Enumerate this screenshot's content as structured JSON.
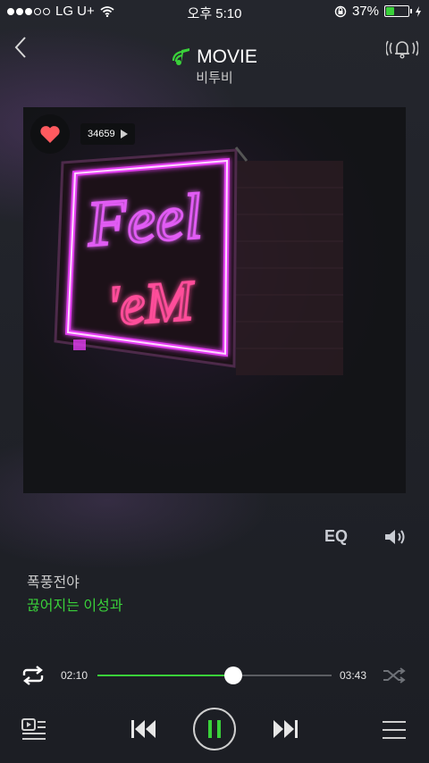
{
  "status_bar": {
    "carrier": "LG U+",
    "time": "오후 5:10",
    "battery": "37%",
    "battery_level": 0.37
  },
  "header": {
    "title": "MOVIE",
    "artist": "비투비"
  },
  "album": {
    "like_count": "34659",
    "art_text_line1": "Feel",
    "art_text_line2": "'eM"
  },
  "controls": {
    "eq_label": "EQ"
  },
  "lyrics": {
    "line1": "폭풍전야",
    "line2": "끊어지는 이성과"
  },
  "progress": {
    "current": "02:10",
    "total": "03:43",
    "fraction": 0.58
  },
  "colors": {
    "accent": "#3ad13a",
    "background": "#1b1d23",
    "heart": "#ff5a5f"
  },
  "icons": [
    "back-icon",
    "music-note-icon",
    "alarm-bell-icon",
    "heart-icon",
    "volume-icon",
    "repeat-icon",
    "shuffle-icon",
    "playlist-icon",
    "previous-icon",
    "pause-icon",
    "next-icon",
    "menu-icon",
    "wifi-icon",
    "rotation-lock-icon",
    "charging-icon"
  ]
}
